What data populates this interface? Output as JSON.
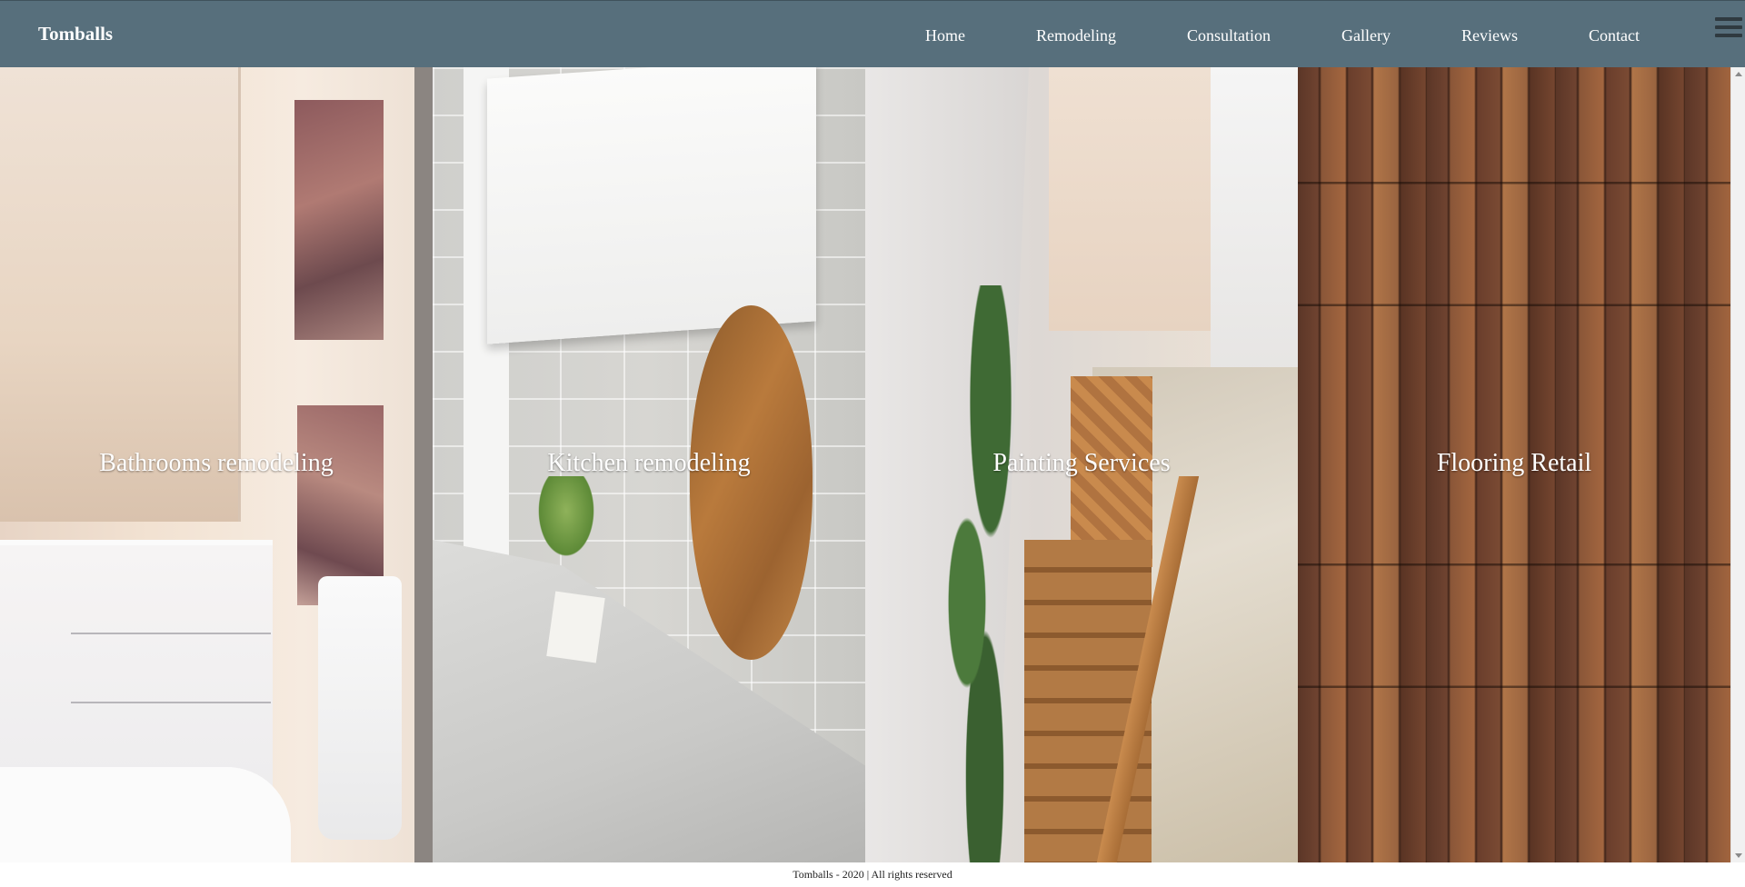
{
  "header": {
    "brand": "Tomballs",
    "nav": [
      {
        "label": "Home"
      },
      {
        "label": "Remodeling"
      },
      {
        "label": "Consultation"
      },
      {
        "label": "Gallery"
      },
      {
        "label": "Reviews"
      },
      {
        "label": "Contact"
      }
    ],
    "menu_icon": "hamburger-menu-icon"
  },
  "panels": [
    {
      "label": "Bathrooms remodeling",
      "image": "bathroom-photo"
    },
    {
      "label": "Kitchen remodeling",
      "image": "kitchen-photo"
    },
    {
      "label": "Painting Services",
      "image": "painted-staircase-photo"
    },
    {
      "label": "Flooring Retail",
      "image": "wood-planks-photo"
    }
  ],
  "footer": {
    "text": "Tomballs - 2020 | All rights reserved"
  },
  "colors": {
    "navbar": "#576f7c",
    "nav_text": "#ffffff"
  }
}
